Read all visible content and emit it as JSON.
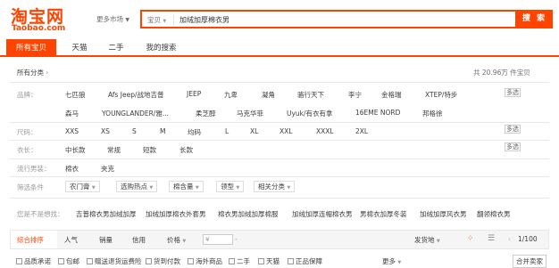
{
  "header": {
    "logo_cn": "淘宝网",
    "logo_en": "Taobao.com",
    "market_label": "更多市场",
    "search_type": "宝贝",
    "search_value": "加绒加厚棉衣男",
    "search_button": "搜 索",
    "accent_color": "#ff4400"
  },
  "tabs": [
    "所有宝贝",
    "天猫",
    "二手",
    "我的搜索"
  ],
  "crumb": {
    "label": "所有分类",
    "total": "共 20.96万 件宝贝"
  },
  "filters": {
    "brand": {
      "label": "品牌：",
      "row1": [
        "七匹狼",
        "Afs Jeep/战地吉普",
        "JEEP",
        "九卑",
        "凝角",
        "骆行天下",
        "李宁",
        "金格瑞",
        "XTEP/特步"
      ],
      "row2": [
        "森马",
        "YOUNGLANDER/雅...",
        "柔芝醇",
        "马克华菲",
        "Uyuk/有衣有拿",
        "16EME NORD",
        "邦格徐"
      ],
      "more": "多选"
    },
    "size": {
      "label": "尺码：",
      "values": [
        "XXS",
        "XS",
        "S",
        "M",
        "均码",
        "L",
        "XL",
        "XXL",
        "XXXL",
        "2XL"
      ],
      "more": "多选"
    },
    "length": {
      "label": "衣长：",
      "values": [
        "中长款",
        "常规",
        "短款",
        "长款"
      ],
      "more": "多选"
    },
    "style": {
      "label": "流行男装：",
      "values": [
        "棉衣",
        "夹克"
      ]
    },
    "extra": {
      "label": "筛选条件",
      "dropdowns": [
        "农门膏",
        "选购热点",
        "棉含量",
        "领型",
        "相关分类"
      ]
    }
  },
  "suggest": {
    "label": "您是不是想找：",
    "items": [
      "吉普棉衣男加绒加厚",
      "加绒加厚棉衣外套男",
      "棉衣男加绒加厚棉服",
      "加绒加厚连帽棉衣男",
      "男棉衣加厚冬装",
      "加绒加厚风衣男",
      "翻领棉衣男"
    ]
  },
  "sort": {
    "items": [
      "综合排序",
      "人气",
      "销量",
      "信用",
      "价格"
    ],
    "price_from": "¥",
    "price_to": "¥",
    "ship_from": "发货地",
    "page": "1/100"
  },
  "checks": [
    "品质承诺",
    "包邮",
    "赠送退货运费险",
    "货到付款",
    "海外商品",
    "二手",
    "天猫",
    "正品保障"
  ],
  "more_label": "更多",
  "merge_label": "合并卖家"
}
